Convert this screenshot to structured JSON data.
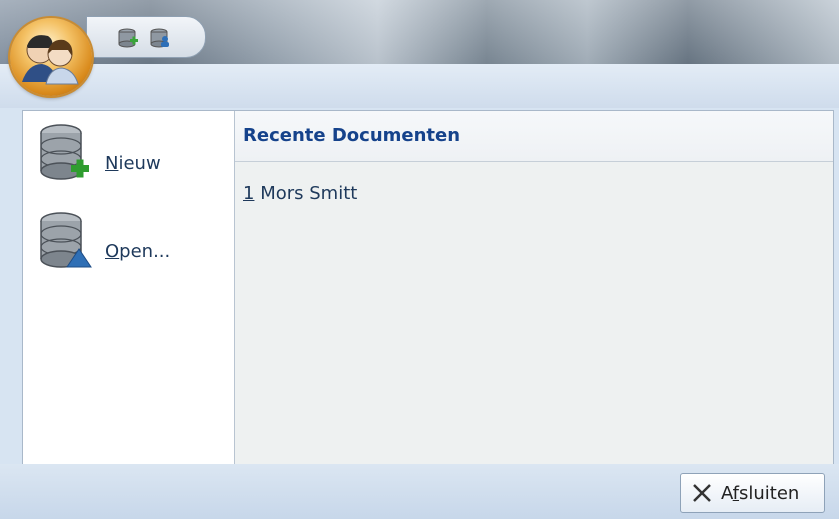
{
  "colors": {
    "accent": "#15428b",
    "text": "#1e395b",
    "panel_bg": "#eef1f1"
  },
  "quick_access": {
    "icons": [
      "database-add-icon",
      "database-user-icon"
    ]
  },
  "menu": {
    "items": [
      {
        "label_prefix": "",
        "mnemonic": "N",
        "label_rest": "ieuw",
        "icon": "database-add-icon"
      },
      {
        "label_prefix": "",
        "mnemonic": "O",
        "label_rest": "pen...",
        "icon": "database-open-icon"
      }
    ]
  },
  "recent": {
    "title": "Recente Documenten",
    "items": [
      {
        "index": "1",
        "name": "Mors Smitt"
      }
    ]
  },
  "footer": {
    "exit_prefix": "A",
    "exit_mnemonic": "f",
    "exit_rest": "sluiten"
  }
}
